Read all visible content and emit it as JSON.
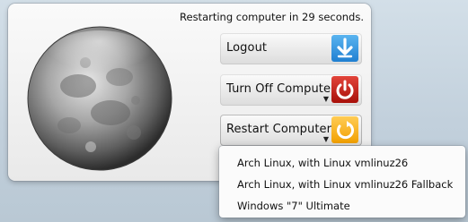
{
  "dialog": {
    "status_text": "Restarting computer in 29 seconds."
  },
  "buttons": {
    "logout": {
      "label": "Logout",
      "icon": "logout-arrow-icon"
    },
    "turn_off": {
      "label": "Turn Off Computer",
      "icon": "power-icon"
    },
    "restart": {
      "label": "Restart Computer",
      "icon": "restart-icon"
    }
  },
  "boot_menu": {
    "items": [
      "Arch Linux, with Linux vmlinuz26",
      "Arch Linux, with Linux vmlinuz26 Fallback",
      "Windows \"7\" Ultimate"
    ]
  },
  "colors": {
    "logout_icon": "#2a8de0",
    "power_icon": "#c8201a",
    "restart_icon": "#f6b21a"
  }
}
